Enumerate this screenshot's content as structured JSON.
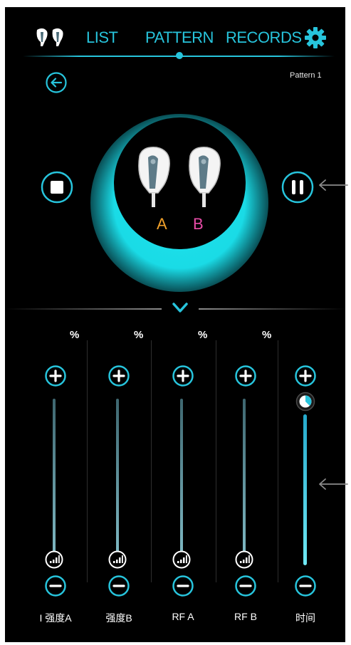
{
  "nav": {
    "tabs": [
      {
        "label": "LIST"
      },
      {
        "label": "PATTERN"
      },
      {
        "label": "RECORDS"
      }
    ],
    "active_tab": "PATTERN",
    "accent_color": "#27c4dc",
    "icons": {
      "devices": "earbud-devices-icon",
      "settings": "gear-icon"
    }
  },
  "header": {
    "pattern_name": "Pattern 1",
    "back_icon": "arrow-left-circle-icon"
  },
  "hero": {
    "label_a": "A",
    "label_b": "B",
    "label_a_color": "#f0a02a",
    "label_b_color": "#e84ca8",
    "glow_color": "#1ee3ec",
    "stop_icon": "stop-circle-icon",
    "pause_icon": "pause-circle-icon",
    "collapse_icon": "chevron-down-icon"
  },
  "sliders": [
    {
      "label": "I 强度A",
      "unit": "%"
    },
    {
      "label": "强度B",
      "unit": "%"
    },
    {
      "label": "RF A",
      "unit": "%"
    },
    {
      "label": "RF B",
      "unit": "%"
    },
    {
      "label": "时间",
      "unit": ""
    }
  ],
  "slider_icons": {
    "increase": "plus-circle-icon",
    "decrease": "minus-circle-icon",
    "level": "signal-level-icon",
    "time_handle": "clock-icon"
  }
}
